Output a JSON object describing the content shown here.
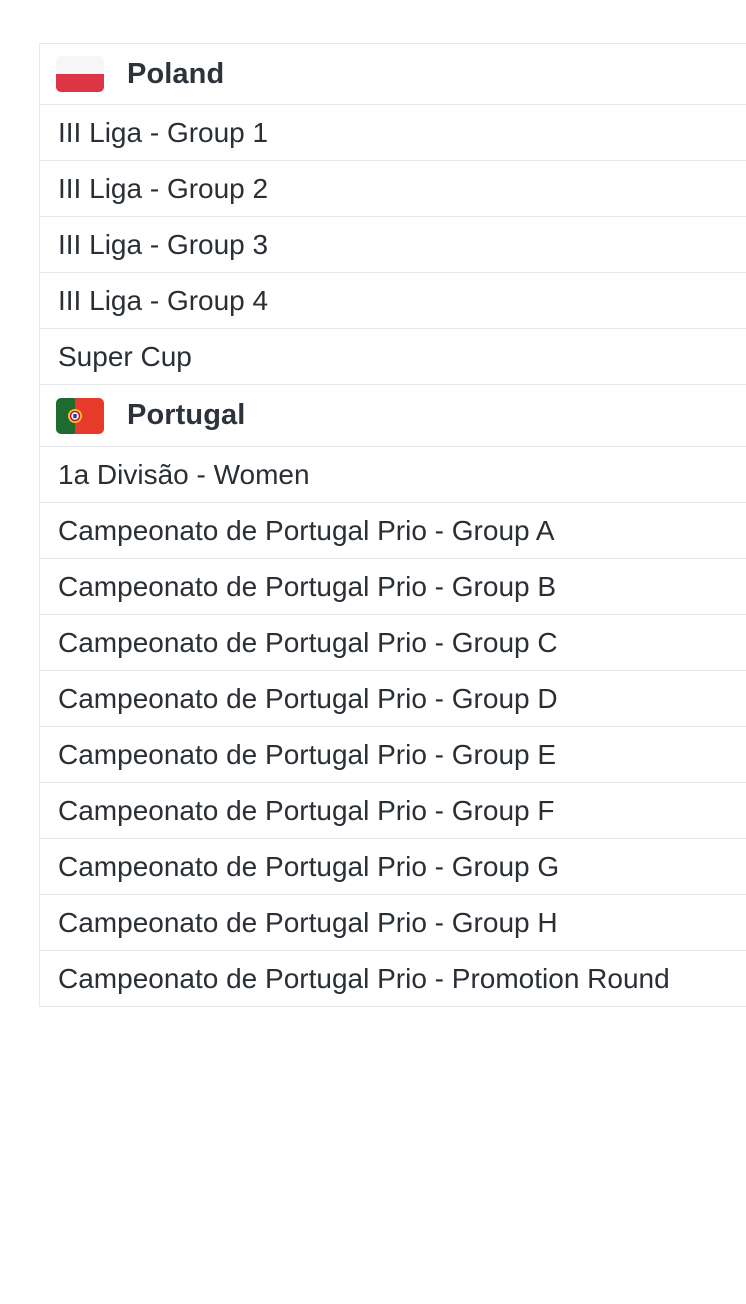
{
  "countries": [
    {
      "name": "Poland",
      "flag_icon": "poland-flag-icon",
      "leagues": [
        "III Liga - Group 1",
        "III Liga - Group 2",
        "III Liga - Group 3",
        "III Liga - Group 4",
        "Super Cup"
      ]
    },
    {
      "name": "Portugal",
      "flag_icon": "portugal-flag-icon",
      "leagues": [
        "1a Divisão - Women",
        "Campeonato de Portugal Prio - Group A",
        "Campeonato de Portugal Prio - Group B",
        "Campeonato de Portugal Prio - Group C",
        "Campeonato de Portugal Prio - Group D",
        "Campeonato de Portugal Prio - Group E",
        "Campeonato de Portugal Prio - Group F",
        "Campeonato de Portugal Prio - Group G",
        "Campeonato de Portugal Prio - Group H",
        "Campeonato de Portugal Prio - Promotion Round"
      ]
    }
  ],
  "colors": {
    "divider": "#e7e9ec",
    "text": "#2a2f36",
    "poland_red": "#dc3545",
    "portugal_green": "#1d6b2e",
    "portugal_red": "#e83a2a"
  }
}
